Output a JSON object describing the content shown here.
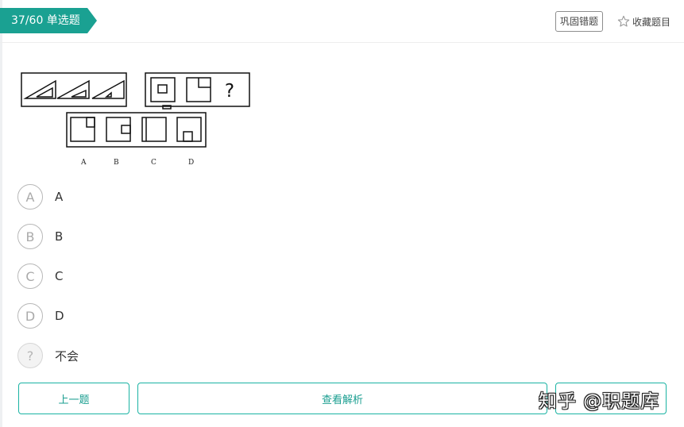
{
  "header": {
    "badge": "37/60 单选题",
    "consolidate_label": "巩固错题",
    "collect_label": "收藏题目"
  },
  "question": {
    "figure_labels": [
      "A",
      "B",
      "C",
      "D"
    ]
  },
  "options": [
    {
      "letter": "A",
      "text": "A"
    },
    {
      "letter": "B",
      "text": "B"
    },
    {
      "letter": "C",
      "text": "C"
    },
    {
      "letter": "D",
      "text": "D"
    },
    {
      "letter": "?",
      "text": "不会"
    }
  ],
  "footer": {
    "prev_label": "上一题",
    "analysis_label": "查看解析"
  },
  "watermark": "知乎 @职题库",
  "colors": {
    "accent": "#1ab3a3",
    "badge": "#1aa192"
  }
}
